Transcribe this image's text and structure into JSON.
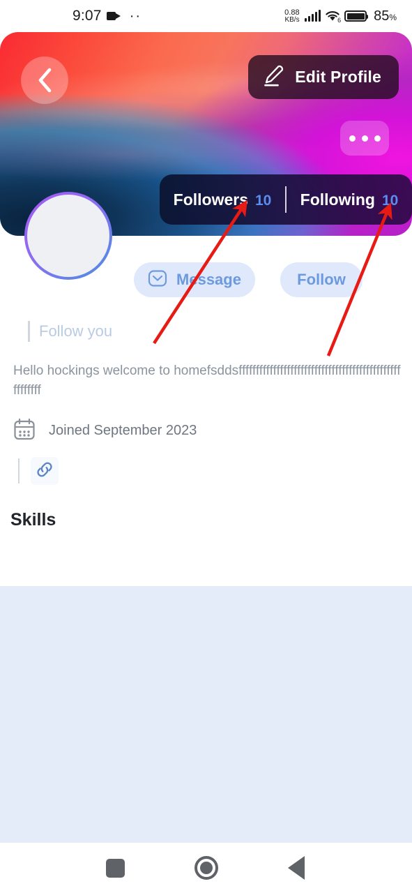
{
  "status_bar": {
    "time": "9:07",
    "camera_icon": "video-camera-icon",
    "menu_dots": "··",
    "net_speed_value": "0.88",
    "net_speed_unit": "KB/s",
    "signal_icon": "cellular-signal-icon",
    "wifi_icon": "wifi-6-icon",
    "wifi_generation": "6",
    "battery_icon": "battery-icon",
    "battery_percent": "85",
    "percent_symbol": "%"
  },
  "banner": {
    "back_icon": "chevron-left-icon",
    "edit_profile_label": "Edit Profile",
    "edit_icon": "pencil-edit-icon",
    "more_icon": "more-horizontal-icon"
  },
  "stats": {
    "followers_label": "Followers",
    "followers_count": "10",
    "following_label": "Following",
    "following_count": "10",
    "count_color": "#5b8def"
  },
  "profile": {
    "avatar": "profile-avatar-placeholder",
    "follow_you_label": "Follow you",
    "bio": "Hello hockings welcome to homefsddsfffffffffffffffffffffffffffffffffffffffffffffffffffffff",
    "joined_label": "Joined September 2023",
    "calendar_icon": "calendar-icon",
    "link_icon": "link-chain-icon"
  },
  "actions": {
    "message_label": "Message",
    "message_icon": "message-envelope-icon",
    "follow_label": "Follow",
    "pill_bg": "#dfe9fb",
    "pill_text_color": "#6d9adf"
  },
  "sections": {
    "skills_title": "Skills"
  },
  "nav_bar": {
    "recent_icon": "recent-apps-square-icon",
    "home_icon": "home-circle-icon",
    "back_icon": "back-triangle-icon"
  },
  "annotations": {
    "arrow_color": "#e81b14",
    "arrow_1_target": "followers-count",
    "arrow_2_target": "following-count"
  }
}
